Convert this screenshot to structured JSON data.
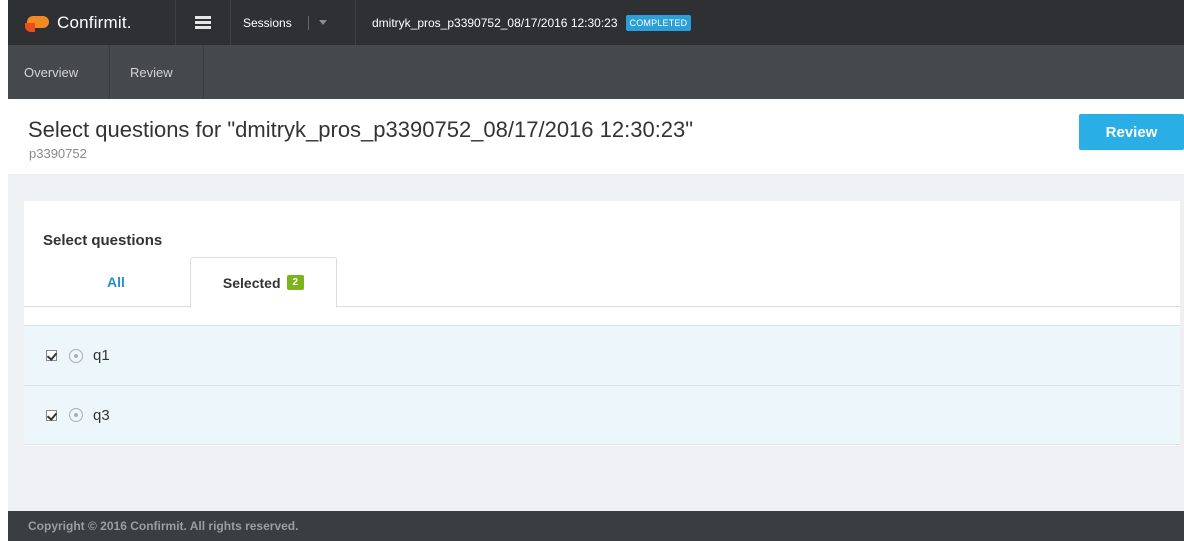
{
  "topbar": {
    "logo_text": "Confirmit.",
    "sessions_label": "Sessions",
    "session_name": "dmitryk_pros_p3390752_08/17/2016 12:30:23",
    "status": "COMPLETED"
  },
  "subnav": {
    "items": [
      "Overview",
      "Review"
    ]
  },
  "header": {
    "title": "Select questions for \"dmitryk_pros_p3390752_08/17/2016 12:30:23\"",
    "subtitle": "p3390752",
    "review_button": "Review"
  },
  "panel": {
    "title": "Select questions",
    "tabs": {
      "all": "All",
      "selected": "Selected",
      "selected_count": "2"
    },
    "questions": [
      {
        "label": "q1",
        "checked": true
      },
      {
        "label": "q3",
        "checked": true
      }
    ]
  },
  "footer": {
    "copyright": "Copyright © 2016 Confirmit. All rights reserved."
  },
  "colors": {
    "topbar_bg": "#2e3033",
    "subnav_bg": "#45484d",
    "accent": "#29aee6",
    "badge_green": "#7ab51d",
    "row_bg": "#edf6fa"
  }
}
